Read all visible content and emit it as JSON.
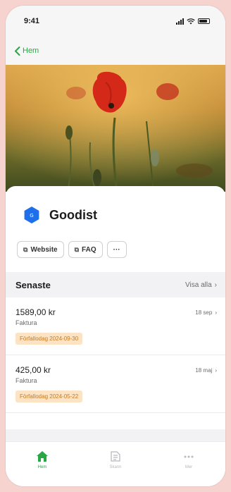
{
  "status_bar": {
    "time": "9:41"
  },
  "nav": {
    "back_label": "Hem"
  },
  "brand": {
    "name": "Goodist"
  },
  "links": {
    "website": "Website",
    "faq": "FAQ",
    "more": "···"
  },
  "section": {
    "title": "Senaste",
    "see_all": "Visa alla",
    "chevron": "›"
  },
  "invoices": [
    {
      "amount": "1589,00 kr",
      "kind": "Faktura",
      "date": "18 sep",
      "due": "Förfallodag 2024-09-30"
    },
    {
      "amount": "425,00 kr",
      "kind": "Faktura",
      "date": "18 maj",
      "due": "Förfallodag 2024-05-22"
    }
  ],
  "tabs": [
    {
      "label": "Hem",
      "icon": "home-icon"
    },
    {
      "label": "Skann",
      "icon": "scan-icon"
    },
    {
      "label": "Mer",
      "icon": "more-icon"
    }
  ],
  "colors": {
    "accent": "#28a745",
    "brand": "#1f6feb",
    "badge_bg": "#fbe3c4",
    "badge_text": "#c97a21",
    "page_bg": "#f7d3cf"
  }
}
